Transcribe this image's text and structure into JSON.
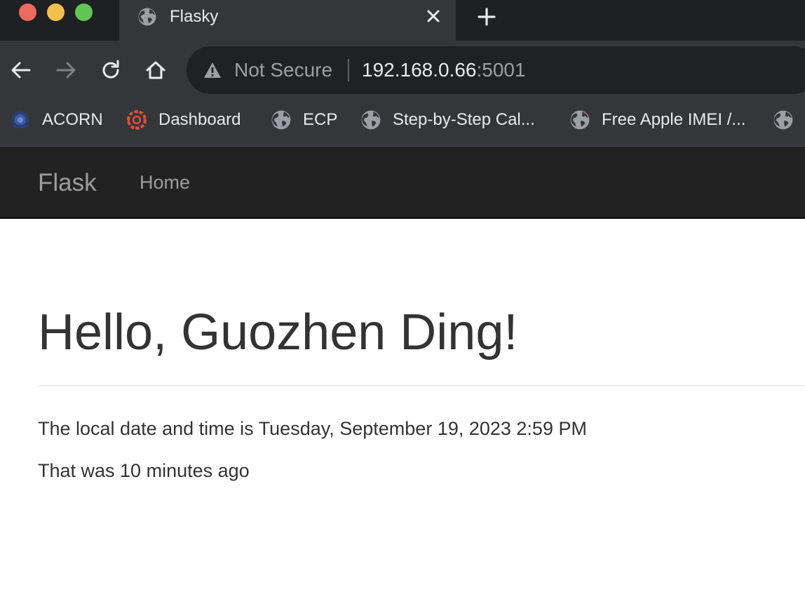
{
  "browser": {
    "tab": {
      "title": "Flasky",
      "favicon": "globe-icon"
    },
    "toolbar": {
      "back": "arrow-left-icon",
      "forward": "arrow-right-icon",
      "reload": "reload-icon",
      "home": "home-icon"
    },
    "omnibox": {
      "security_label": "Not Secure",
      "url_host": "192.168.0.66",
      "url_port": ":5001"
    },
    "bookmarks": [
      {
        "label": "ACORN",
        "icon": "acorn-logo-icon"
      },
      {
        "label": "Dashboard",
        "icon": "canvas-logo-icon"
      },
      {
        "label": "ECP",
        "icon": "globe-icon"
      },
      {
        "label": "Step-by-Step Cal...",
        "icon": "globe-icon"
      },
      {
        "label": "Free Apple IMEI /...",
        "icon": "globe-icon"
      },
      {
        "label": "",
        "icon": "globe-icon"
      }
    ],
    "colors": {
      "tabstrip": "#1f2023",
      "toolbar": "#35363a",
      "omnibox": "#202124",
      "traffic_red": "#ed6a5e",
      "traffic_yellow": "#f4bf4f",
      "traffic_green": "#61c554"
    }
  },
  "page": {
    "navbar": {
      "brand": "Flask",
      "links": [
        "Home"
      ]
    },
    "heading": "Hello, Guozhen Ding!",
    "local_time_text": "The local date and time is Tuesday, September 19, 2023 2:59 PM",
    "relative_time_text": "That was 10 minutes ago",
    "colors": {
      "navbar_bg": "#222222",
      "navbar_text": "#9d9d9d",
      "body_text": "#333333"
    }
  }
}
